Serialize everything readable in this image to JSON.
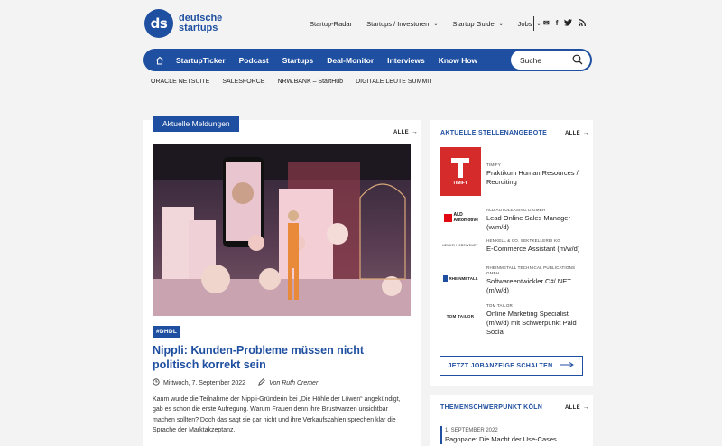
{
  "logo": {
    "mark": "ds",
    "line1": "deutsche",
    "line2": "startups"
  },
  "topnav": {
    "items": [
      {
        "label": "Startup-Radar",
        "dropdown": false
      },
      {
        "label": "Startups / Investoren",
        "dropdown": true
      },
      {
        "label": "Startup Guide",
        "dropdown": true
      },
      {
        "label": "Jobs",
        "dropdown": true
      }
    ],
    "social_icons": [
      "mail-icon",
      "facebook-icon",
      "twitter-icon",
      "rss-icon"
    ]
  },
  "mainnav": {
    "items": [
      "StartupTicker",
      "Podcast",
      "Startups",
      "Deal-Monitor",
      "Interviews",
      "Know How"
    ],
    "search_placeholder": "Suche"
  },
  "subnav": [
    "ORACLE NETSUITE",
    "SALESFORCE",
    "NRW.BANK – StartHub",
    "DIGITALE LEUTE SUMMIT"
  ],
  "news": {
    "heading": "Aktuelle Meldungen",
    "all_label": "ALLE",
    "article": {
      "tag": "#DHDL",
      "title": "Nippli: Kunden-Probleme müssen nicht politisch korrekt sein",
      "date": "Mittwoch, 7. September 2022",
      "by": "Von",
      "author": "Ruth Cremer",
      "excerpt": "Kaum wurde die Teilnahme der Nippli-Gründerin bei „Die Höhle der Löwen“ angekündigt, gab es schon die erste Aufregung. Warum Frauen denn ihre Brustwarzen unsichtbar machen sollten? Doch das sagt sie gar nicht und ihre Verkaufszahlen sprechen klar die Sprache der Marktakzeptanz."
    }
  },
  "jobs": {
    "heading": "AKTUELLE STELLENANGEBOTE",
    "all_label": "ALLE",
    "items": [
      {
        "company": "TIMIFY",
        "title": "Praktikum Human Resources / Recruiting",
        "logo_text": "TIMIFY"
      },
      {
        "company": "ALD AUTOLEASING D GMBH",
        "title": "Lead Online Sales Manager (w/m/d)",
        "logo_text": "ALD Automotive"
      },
      {
        "company": "HENKELL & CO. SEKTKELLEREI KG",
        "title": "E-Commerce Assistant (m/w/d)",
        "logo_text": "HENKELL FREIXENET"
      },
      {
        "company": "RHEINMETALL TECHNICAL PUBLICATIONS GMBH",
        "title": "Softwareentwickler C#/.NET (m/w/d)",
        "logo_text": "RHEINMETALL"
      },
      {
        "company": "TOM TAILOR",
        "title": "Online Marketing Specialist (m/w/d) mit Schwerpunkt Paid Social",
        "logo_text": "TOM TAILOR"
      }
    ],
    "button": "JETZT JOBANZEIGE SCHALTEN"
  },
  "theme": {
    "heading": "THEMENSCHWERPUNKT KÖLN",
    "all_label": "ALLE",
    "date": "1. SEPTEMBER 2022",
    "title": "Pagopace: Die Macht der Use-Cases"
  },
  "colors": {
    "brand": "#1f4fa0",
    "timify_red": "#d62b2b",
    "ald_red": "#e30613"
  }
}
